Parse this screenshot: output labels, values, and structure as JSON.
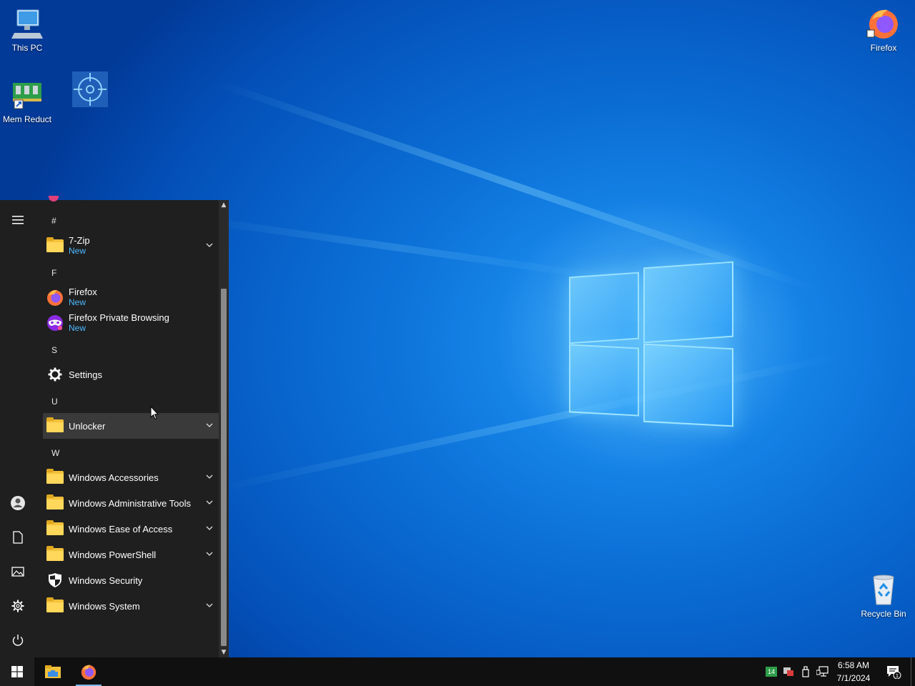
{
  "desktop": {
    "icons": {
      "this_pc": "This PC",
      "mem_reduct": "Mem Reduct",
      "firefox": "Firefox",
      "recycle_bin": "Recycle Bin"
    }
  },
  "start_menu": {
    "groups": {
      "hash": "#",
      "f": "F",
      "s": "S",
      "u": "U",
      "w": "W"
    },
    "items": {
      "zip": {
        "label": "7-Zip",
        "sub": "New"
      },
      "firefox": {
        "label": "Firefox",
        "sub": "New"
      },
      "firefox_private": {
        "label": "Firefox Private Browsing",
        "sub": "New"
      },
      "settings": {
        "label": "Settings"
      },
      "unlocker": {
        "label": "Unlocker"
      },
      "win_accessories": {
        "label": "Windows Accessories"
      },
      "win_admin_tools": {
        "label": "Windows Administrative Tools"
      },
      "win_ease": {
        "label": "Windows Ease of Access"
      },
      "win_powershell": {
        "label": "Windows PowerShell"
      },
      "win_security": {
        "label": "Windows Security"
      },
      "win_system": {
        "label": "Windows System"
      }
    }
  },
  "taskbar": {
    "tray_badge": "14",
    "time": "6:58 AM",
    "date": "7/1/2024",
    "notification_count": "1"
  },
  "colors": {
    "accent": "#4db8ff",
    "menu_bg": "#1f1f1f",
    "folder": "#f3c13a"
  }
}
